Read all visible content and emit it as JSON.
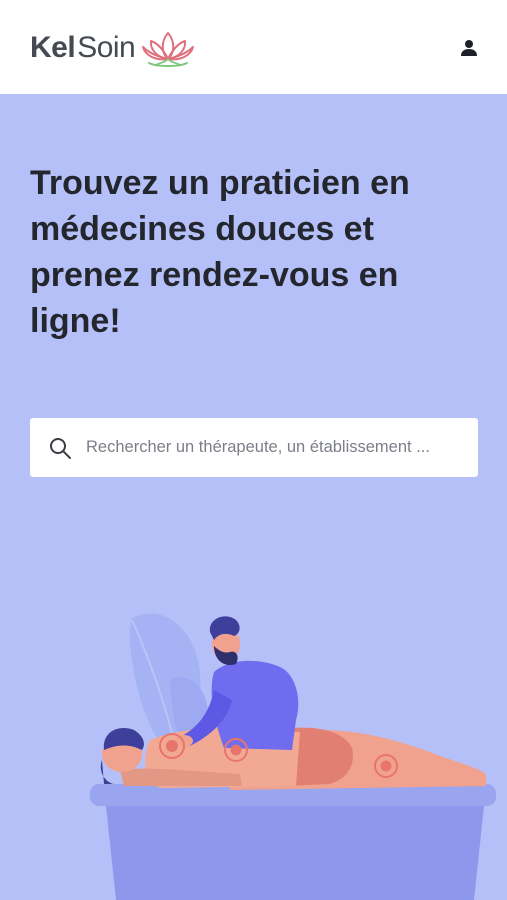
{
  "header": {
    "logo_part1": "Kel",
    "logo_part2": "Soin",
    "logo_icon": "lotus-icon",
    "user_icon": "user-icon"
  },
  "hero": {
    "title": "Trouvez un praticien en médecines douces et prenez rendez-vous en ligne!"
  },
  "search": {
    "icon": "search-icon",
    "placeholder": "Rechercher un thérapeute, un établissement ..."
  },
  "colors": {
    "background": "#b5c0f8",
    "header": "#ffffff",
    "title": "#23262d",
    "accent_lotus": "#e0707c",
    "table": "#8f9bee"
  }
}
